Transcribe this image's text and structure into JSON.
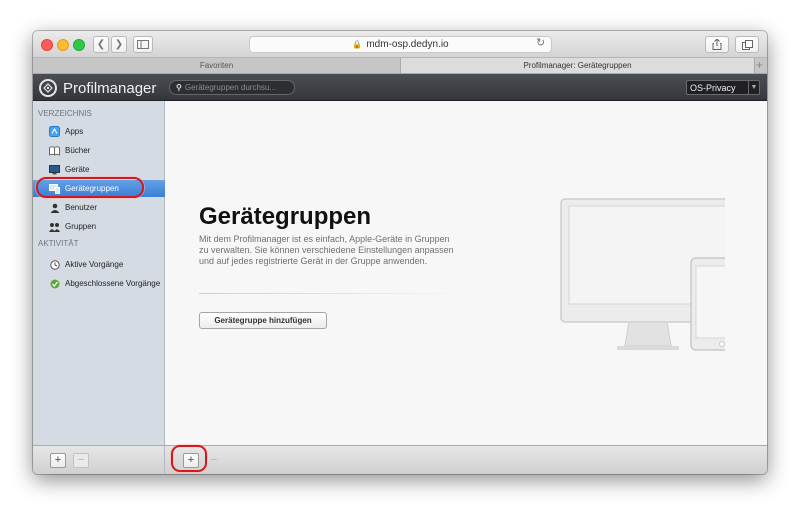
{
  "browser": {
    "url": "mdm-osp.dedyn.io",
    "tabs": [
      {
        "label": "Favoriten"
      },
      {
        "label": "Profilmanager: Gerätegruppen"
      }
    ],
    "new_tab_label": "+"
  },
  "app": {
    "title": "Profilmanager",
    "search_placeholder": "Gerätegruppen durchsu...",
    "org_selected": "OS-Privacy"
  },
  "sidebar": {
    "sections": [
      {
        "title": "VERZEICHNIS"
      },
      {
        "title": "AKTIVITÄT"
      }
    ],
    "items": [
      {
        "label": "Apps",
        "icon": "apps-icon"
      },
      {
        "label": "Bücher",
        "icon": "book-icon"
      },
      {
        "label": "Geräte",
        "icon": "device-icon"
      },
      {
        "label": "Gerätegruppen",
        "icon": "device-group-icon",
        "selected": true
      },
      {
        "label": "Benutzer",
        "icon": "user-icon"
      },
      {
        "label": "Gruppen",
        "icon": "group-icon"
      },
      {
        "label": "Aktive Vorgänge",
        "icon": "clock-icon"
      },
      {
        "label": "Abgeschlossene Vorgänge",
        "icon": "check-icon"
      }
    ],
    "add_label": "+",
    "remove_label": "−"
  },
  "main": {
    "title": "Gerätegruppen",
    "description": "Mit dem Profilmanager ist es einfach, Apple-Geräte in Gruppen zu verwalten. Sie können verschiedene Einstellungen anpassen und auf jedes registrierte Gerät in der Gruppe anwenden.",
    "add_button_label": "Gerätegruppe hinzufügen"
  },
  "footer": {
    "add_label": "+",
    "remove_label": "−"
  },
  "colors": {
    "selection": "#3a7fd6",
    "annotation": "#d31920",
    "header": "#3b3e42"
  }
}
